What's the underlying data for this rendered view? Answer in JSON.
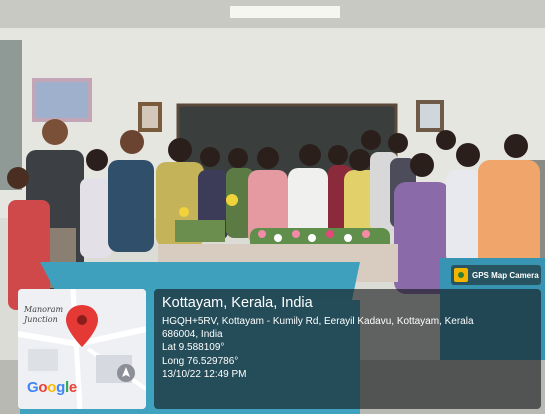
{
  "badge": {
    "text": "GPS Map Camera",
    "icon": "camera-icon",
    "color": "#f2b400"
  },
  "overlay": {
    "title": "Kottayam, Kerala, India",
    "address_1": "HGQH+5RV, Kottayam - Kumily Rd, Eerayil Kadavu, Kottayam, Kerala",
    "address_2": "686004, India",
    "lat": "Lat 9.588109°",
    "long": "Long 76.529786°",
    "datetime": "13/10/22 12:49 PM"
  },
  "minimap": {
    "place_label_1": "Manoram",
    "place_label_2": "Junction",
    "pin_color": "#e53935",
    "logo": "Google"
  },
  "photo": {
    "scene": "classroom-group-photo",
    "wall_color": "#e8e8e4",
    "board_color": "#3a3f3d",
    "table_color": "#3ea0bd"
  }
}
